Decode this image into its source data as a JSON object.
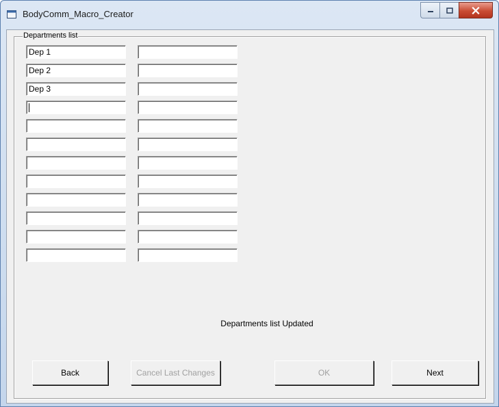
{
  "window": {
    "title": "BodyComm_Macro_Creator"
  },
  "group": {
    "legend": "Departments list"
  },
  "left_fields": [
    "Dep 1",
    "Dep 2",
    "Dep 3",
    "",
    "",
    "",
    "",
    "",
    "",
    "",
    "",
    ""
  ],
  "right_fields": [
    "",
    "",
    "",
    "",
    "",
    "",
    "",
    "",
    "",
    "",
    "",
    ""
  ],
  "status_message": "Departments list Updated",
  "buttons": {
    "back": "Back",
    "cancel": "Cancel Last Changes",
    "ok": "OK",
    "next": "Next"
  }
}
